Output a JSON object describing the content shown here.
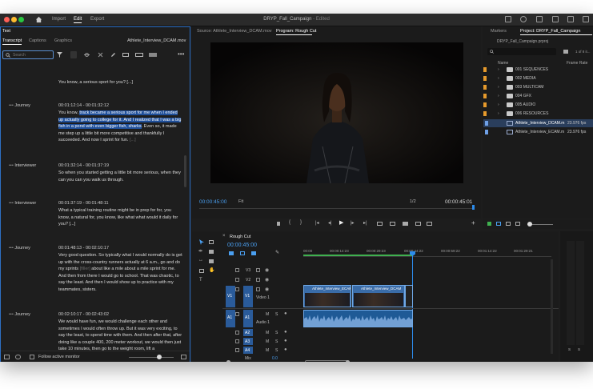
{
  "app": {
    "title": "DRYP_Fall_Campaign",
    "title_status": "- Edited",
    "nav": {
      "import": "Import",
      "edit": "Edit",
      "export": "Export"
    }
  },
  "text_panel": {
    "panel_title": "Text",
    "tabs": [
      "Transcript",
      "Captions",
      "Graphics"
    ],
    "source_file": "Athlete_Interview_DCAM.mov",
    "search_placeholder": "Search",
    "entries": [
      {
        "speaker": "",
        "time": "",
        "text": "You know, a serious sport for you? [...]"
      },
      {
        "speaker": "Journey",
        "time": "00:01:12:14 - 00:01:32:12",
        "text_before": "You know, ",
        "text_highlight": "track became a serious sport for me when I ended up actually going to college for it. And I realized that I was a big fish in a pond with even bigger fish, sharks",
        "text_after": ". Even so, it made me step up a little bit more competitive and thankfully I succeeded. And now I sprint for fun.",
        "text_dim": "[...]"
      },
      {
        "speaker": "Interviewer",
        "time": "00:01:32:14 - 00:01:37:19",
        "text": "So when you started getting a little bit more serious, when they can you can you walk us through."
      },
      {
        "speaker": "Interviewer",
        "time": "00:01:37:19 - 00:01:48:11",
        "text": "What a typical training routine might be in prep for for, you know, a natural for, you know, like what what would it daily for you? [...]"
      },
      {
        "speaker": "Journey",
        "time": "00:01:48:13 - 00:02:10:17",
        "text_before": "Very good question. So typically what I would normally do is get up with the cross-country runners actually at 6 a.m., go and do my sprints ",
        "text_dim": "[filler]",
        "text_after": " about like a mile about a mile sprint for me. And then from there I would go to school. That was chaotic, to say the least. And then I would show up to practice with my teammates, sisters."
      },
      {
        "speaker": "Journey",
        "time": "00:02:10:17 - 00:02:43:02",
        "text": "We would have fun, we would challenge each other and sometimes I would often throw up. But it was very exciting, to say the least, to spend time with them. And then after that, after doing like a couple 400, 200 meter workout, we would then just take 10 minutes, then go to the weight room, lift a"
      }
    ],
    "footer_label": "Follow active monitor"
  },
  "source_monitor": {
    "tab": "Source: Athlete_Interview_DCAM.mov"
  },
  "program_monitor": {
    "tab": "Program: Rough Cut",
    "timecode_current": "00:00:45:00",
    "timecode_duration": "00:00:45:01",
    "fit": "Fit",
    "ratio": "1/2"
  },
  "project_panel": {
    "tabs": [
      "Markers",
      "Project: DRYP_Fall_Campaign"
    ],
    "project_file": "DRYP_Fall_Campaign.prproj",
    "item_count": "1 of 8 it...",
    "col_name": "Name",
    "col_rate": "Frame Rate",
    "items": [
      {
        "name": "001 SEQUENCES",
        "type": "folder",
        "rate": ""
      },
      {
        "name": "002 MEDIA",
        "type": "folder",
        "rate": ""
      },
      {
        "name": "003 MULTICAM",
        "type": "folder",
        "rate": ""
      },
      {
        "name": "004 GFX",
        "type": "folder",
        "rate": ""
      },
      {
        "name": "005 AUDIO",
        "type": "folder",
        "rate": ""
      },
      {
        "name": "006 RESOURCES",
        "type": "folder",
        "rate": ""
      },
      {
        "name": "Athlete_Interview_DCAM.m",
        "type": "clip",
        "rate": "23.976 fps"
      },
      {
        "name": "Athlete_Interview_ECAM.m",
        "type": "clip",
        "rate": "23.976 fps"
      }
    ]
  },
  "timeline": {
    "sequence_tab": "Rough Cut",
    "timecode": "00:00:45:00",
    "ruler": [
      "00:00",
      "00:00:14:23",
      "00:00:29:23",
      "00:00:44:22",
      "00:00:59:22",
      "00:01:14:22",
      "00:01:29:21"
    ],
    "video_tracks": [
      "V3",
      "V2",
      "V1"
    ],
    "video1_name": "Video 1",
    "audio_tracks": [
      "A1",
      "A2",
      "A3",
      "A4"
    ],
    "audio1_name": "Audio 1",
    "mix_label": "Mix",
    "mix_value": "0.0",
    "clip_name_1": "Athlete_Interview_ECAM",
    "clip_name_2": "Athlete_Interview_DCAM"
  },
  "audio_meter": {
    "labels": [
      "S",
      "S"
    ]
  },
  "colors": {
    "accent": "#2d8ceb",
    "highlight": "#1f4f9a",
    "folder": "#e69a2c",
    "clip_video": "#3a6ca8",
    "clip_audio": "#1f5a96"
  }
}
